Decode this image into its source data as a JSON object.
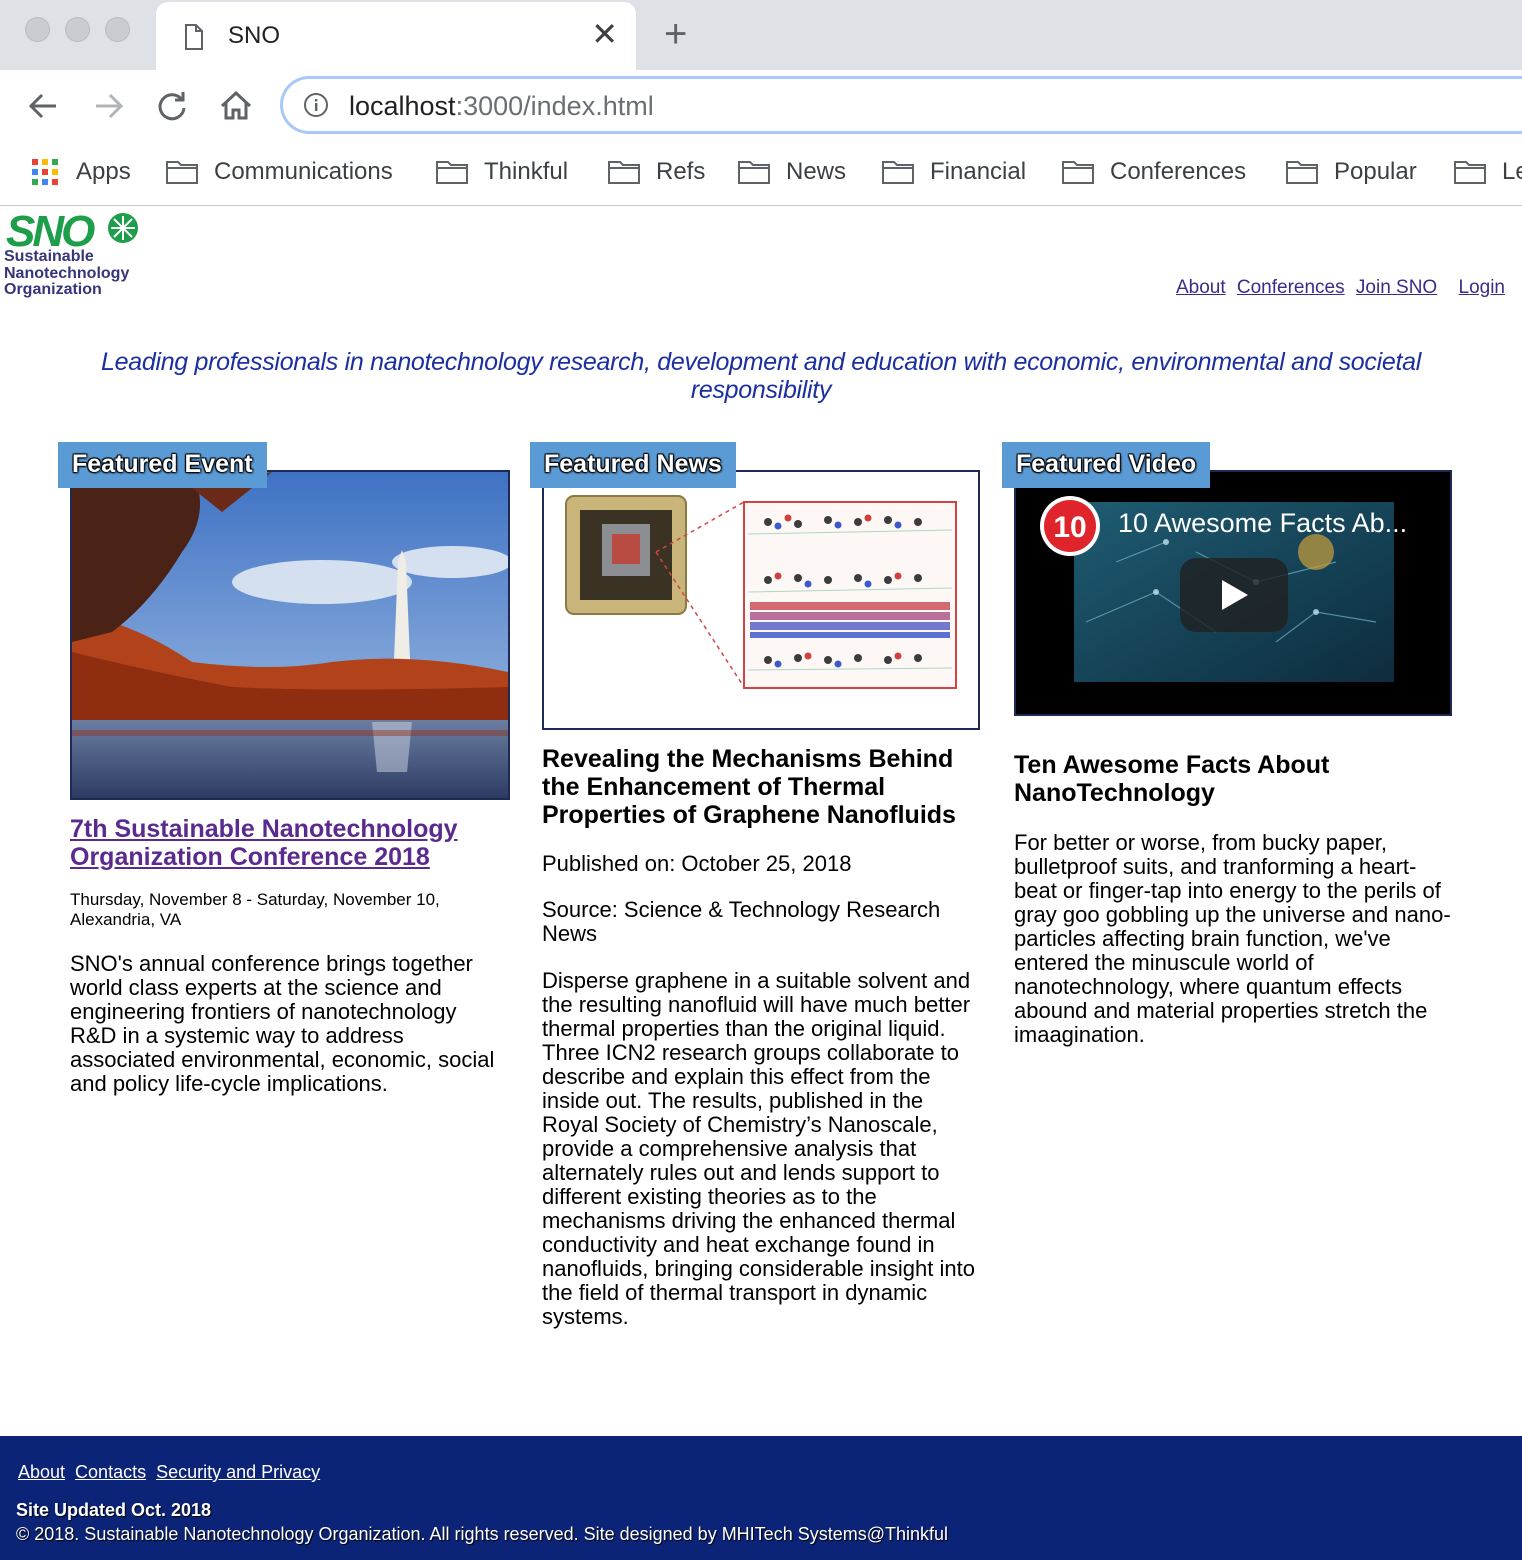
{
  "browser": {
    "tab_title": "SNO",
    "url_host": "localhost",
    "url_rest": ":3000/index.html",
    "bookmarks": [
      "Apps",
      "Communications",
      "Thinkful",
      "Refs",
      "News",
      "Financial",
      "Conferences",
      "Popular",
      "Le"
    ]
  },
  "header": {
    "logo_letters": "SNO",
    "logo_lines": [
      "Sustainable",
      "Nanotechnology",
      "Organization"
    ],
    "nav": [
      "About",
      "Conferences",
      "Join SNO",
      "Login"
    ]
  },
  "tagline": "Leading professionals in nanotechnology research, development and education with economic, environmental and societal responsibility",
  "event": {
    "label": "Featured Event",
    "title": "7th Sustainable Nanotechnology Organization Conference 2018",
    "dates": "Thursday, November 8 - Saturday, November 10, Alexandria, VA",
    "body": "SNO's annual conference brings together world class experts at the science and engineering frontiers of nanotechnology R&D in a systemic way to address associated environmental, economic, social and policy life-cycle implications."
  },
  "news": {
    "label": "Featured News",
    "title": "Revealing the Mechanisms Behind the Enhancement of Thermal Properties of Graphene Nanofluids",
    "published": "Published on: October 25, 2018",
    "source": "Source: Science & Technology Research News",
    "body": "Disperse graphene in a suitable solvent and the resulting nanofluid will have much better thermal properties than the original liquid. Three ICN2 research groups collaborate to describe and explain this effect from the inside out. The results, published in the Royal Society of Chemistry’s Nanoscale, provide a comprehensive analysis that alternately rules out and lends support to different existing theories as to the mechanisms driving the enhanced thermal conductivity and heat exchange found in nanofluids, bringing considerable insight into the field of thermal transport in dynamic systems."
  },
  "video": {
    "label": "Featured Video",
    "badge": "10",
    "video_title": "10 Awesome Facts Ab...",
    "title": "Ten Awesome Facts About NanoTechnology",
    "body": "For better or worse, from bucky paper, bulletproof suits, and tranforming a heart-beat or finger-tap into energy to the perils of gray goo gobbling up the universe and nano-particles affecting brain function, we've entered the minuscule world of nanotechnology, where quantum effects abound and material properties stretch the imaagination."
  },
  "footer": {
    "links": [
      "About",
      "Contacts",
      "Security and Privacy"
    ],
    "updated": "Site Updated Oct. 2018",
    "copyright": "© 2018. Sustainable Nanotechnology Organization. All rights reserved. Site designed by MHITech Systems@Thinkful"
  },
  "colors": {
    "footer_bg": "#0c2478",
    "label_bg": "#5b9bd5",
    "tagline": "#1c2f9e",
    "link": "#3a2b8c",
    "logo_green": "#1e9e4a"
  }
}
